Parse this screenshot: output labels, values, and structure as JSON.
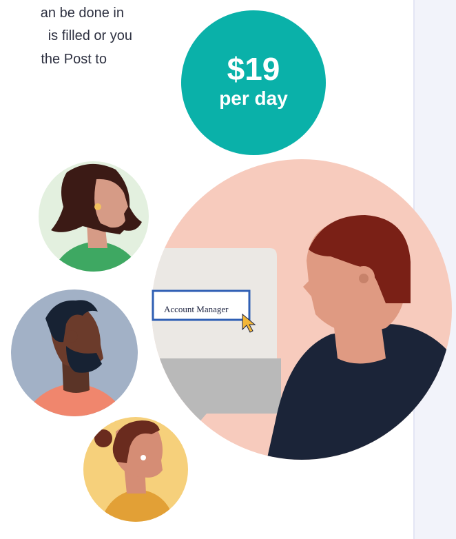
{
  "intro_text": {
    "lines": [
      "an be done in",
      "is filled or you",
      " the Post to"
    ]
  },
  "price_badge": {
    "amount": "$19",
    "unit": "per day"
  },
  "illustration": {
    "screen_label": "Account Manager",
    "icons": [
      "woman-avatar-icon",
      "man-avatar-icon",
      "woman-bun-avatar-icon",
      "cursor-icon"
    ]
  },
  "colors": {
    "badge_teal": "#0ab1a9",
    "peach": "#f7cbbd",
    "green_bg": "#e3f0df",
    "blue_gray_bg": "#a2b1c6",
    "yellow_bg": "#f6d07b"
  }
}
